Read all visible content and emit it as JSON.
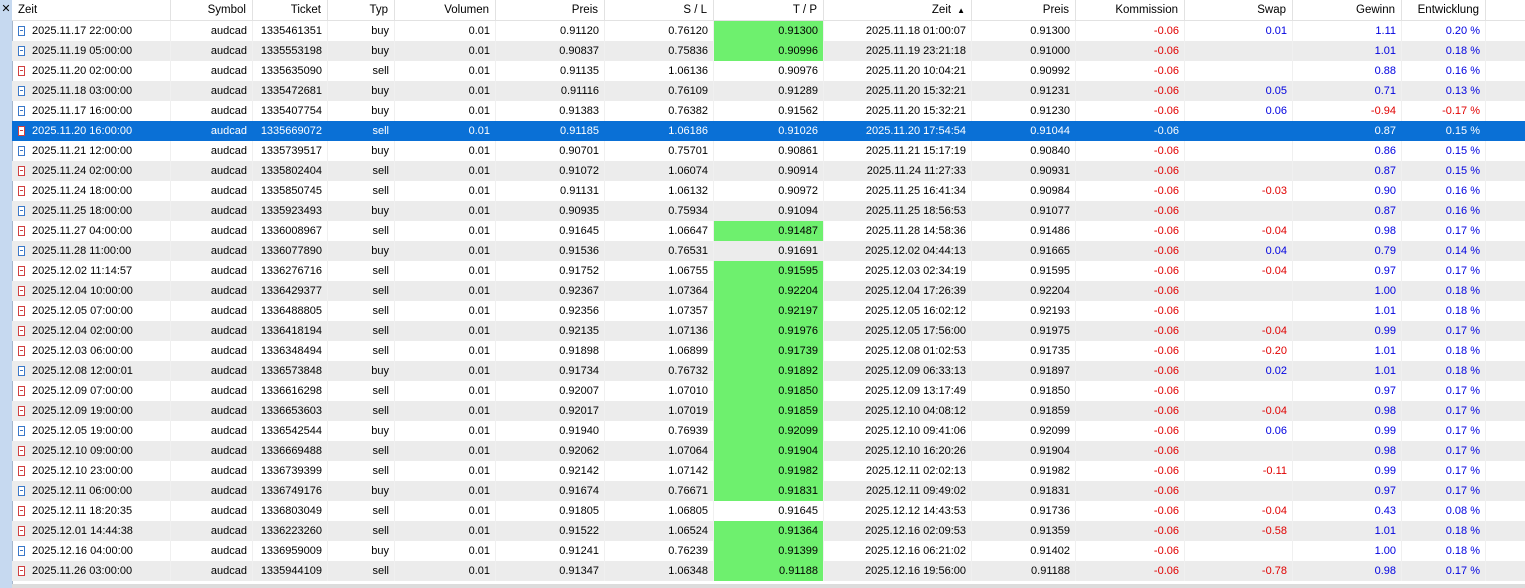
{
  "columns": [
    "Zeit",
    "Symbol",
    "Ticket",
    "Typ",
    "Volumen",
    "Preis",
    "S / L",
    "T / P",
    "Zeit",
    "Preis",
    "Kommission",
    "Swap",
    "Gewinn",
    "Entwicklung"
  ],
  "sort": {
    "column_index": 8,
    "direction": "ascending"
  },
  "colors": {
    "selected_row": "#0a70d6",
    "tp_hit": "#6ef06e",
    "negative": "#e00000",
    "positive": "#0000e0",
    "alt_row": "#ececec"
  },
  "selected_index": 5,
  "rows": [
    {
      "open_time": "2025.11.17 22:00:00",
      "symbol": "audcad",
      "ticket": "1335461351",
      "type": "buy",
      "volume": "0.01",
      "open_price": "0.91120",
      "sl": "0.76120",
      "tp": "0.91300",
      "tp_hit": true,
      "close_time": "2025.11.18 01:00:07",
      "close_price": "0.91300",
      "commission": "-0.06",
      "swap": "0.01",
      "profit": "1.11",
      "change": "0.20 %"
    },
    {
      "open_time": "2025.11.19 05:00:00",
      "symbol": "audcad",
      "ticket": "1335553198",
      "type": "buy",
      "volume": "0.01",
      "open_price": "0.90837",
      "sl": "0.75836",
      "tp": "0.90996",
      "tp_hit": true,
      "close_time": "2025.11.19 23:21:18",
      "close_price": "0.91000",
      "commission": "-0.06",
      "swap": "",
      "profit": "1.01",
      "change": "0.18 %"
    },
    {
      "open_time": "2025.11.20 02:00:00",
      "symbol": "audcad",
      "ticket": "1335635090",
      "type": "sell",
      "volume": "0.01",
      "open_price": "0.91135",
      "sl": "1.06136",
      "tp": "0.90976",
      "tp_hit": false,
      "close_time": "2025.11.20 10:04:21",
      "close_price": "0.90992",
      "commission": "-0.06",
      "swap": "",
      "profit": "0.88",
      "change": "0.16 %"
    },
    {
      "open_time": "2025.11.18 03:00:00",
      "symbol": "audcad",
      "ticket": "1335472681",
      "type": "buy",
      "volume": "0.01",
      "open_price": "0.91116",
      "sl": "0.76109",
      "tp": "0.91289",
      "tp_hit": false,
      "close_time": "2025.11.20 15:32:21",
      "close_price": "0.91231",
      "commission": "-0.06",
      "swap": "0.05",
      "profit": "0.71",
      "change": "0.13 %"
    },
    {
      "open_time": "2025.11.17 16:00:00",
      "symbol": "audcad",
      "ticket": "1335407754",
      "type": "buy",
      "volume": "0.01",
      "open_price": "0.91383",
      "sl": "0.76382",
      "tp": "0.91562",
      "tp_hit": false,
      "close_time": "2025.11.20 15:32:21",
      "close_price": "0.91230",
      "commission": "-0.06",
      "swap": "0.06",
      "profit": "-0.94",
      "change": "-0.17 %"
    },
    {
      "open_time": "2025.11.20 16:00:00",
      "symbol": "audcad",
      "ticket": "1335669072",
      "type": "sell",
      "volume": "0.01",
      "open_price": "0.91185",
      "sl": "1.06186",
      "tp": "0.91026",
      "tp_hit": false,
      "close_time": "2025.11.20 17:54:54",
      "close_price": "0.91044",
      "commission": "-0.06",
      "swap": "",
      "profit": "0.87",
      "change": "0.15 %"
    },
    {
      "open_time": "2025.11.21 12:00:00",
      "symbol": "audcad",
      "ticket": "1335739517",
      "type": "buy",
      "volume": "0.01",
      "open_price": "0.90701",
      "sl": "0.75701",
      "tp": "0.90861",
      "tp_hit": false,
      "close_time": "2025.11.21 15:17:19",
      "close_price": "0.90840",
      "commission": "-0.06",
      "swap": "",
      "profit": "0.86",
      "change": "0.15 %"
    },
    {
      "open_time": "2025.11.24 02:00:00",
      "symbol": "audcad",
      "ticket": "1335802404",
      "type": "sell",
      "volume": "0.01",
      "open_price": "0.91072",
      "sl": "1.06074",
      "tp": "0.90914",
      "tp_hit": false,
      "close_time": "2025.11.24 11:27:33",
      "close_price": "0.90931",
      "commission": "-0.06",
      "swap": "",
      "profit": "0.87",
      "change": "0.15 %"
    },
    {
      "open_time": "2025.11.24 18:00:00",
      "symbol": "audcad",
      "ticket": "1335850745",
      "type": "sell",
      "volume": "0.01",
      "open_price": "0.91131",
      "sl": "1.06132",
      "tp": "0.90972",
      "tp_hit": false,
      "close_time": "2025.11.25 16:41:34",
      "close_price": "0.90984",
      "commission": "-0.06",
      "swap": "-0.03",
      "profit": "0.90",
      "change": "0.16 %"
    },
    {
      "open_time": "2025.11.25 18:00:00",
      "symbol": "audcad",
      "ticket": "1335923493",
      "type": "buy",
      "volume": "0.01",
      "open_price": "0.90935",
      "sl": "0.75934",
      "tp": "0.91094",
      "tp_hit": false,
      "close_time": "2025.11.25 18:56:53",
      "close_price": "0.91077",
      "commission": "-0.06",
      "swap": "",
      "profit": "0.87",
      "change": "0.16 %"
    },
    {
      "open_time": "2025.11.27 04:00:00",
      "symbol": "audcad",
      "ticket": "1336008967",
      "type": "sell",
      "volume": "0.01",
      "open_price": "0.91645",
      "sl": "1.06647",
      "tp": "0.91487",
      "tp_hit": true,
      "close_time": "2025.11.28 14:58:36",
      "close_price": "0.91486",
      "commission": "-0.06",
      "swap": "-0.04",
      "profit": "0.98",
      "change": "0.17 %"
    },
    {
      "open_time": "2025.11.28 11:00:00",
      "symbol": "audcad",
      "ticket": "1336077890",
      "type": "buy",
      "volume": "0.01",
      "open_price": "0.91536",
      "sl": "0.76531",
      "tp": "0.91691",
      "tp_hit": false,
      "close_time": "2025.12.02 04:44:13",
      "close_price": "0.91665",
      "commission": "-0.06",
      "swap": "0.04",
      "profit": "0.79",
      "change": "0.14 %"
    },
    {
      "open_time": "2025.12.02 11:14:57",
      "symbol": "audcad",
      "ticket": "1336276716",
      "type": "sell",
      "volume": "0.01",
      "open_price": "0.91752",
      "sl": "1.06755",
      "tp": "0.91595",
      "tp_hit": true,
      "close_time": "2025.12.03 02:34:19",
      "close_price": "0.91595",
      "commission": "-0.06",
      "swap": "-0.04",
      "profit": "0.97",
      "change": "0.17 %"
    },
    {
      "open_time": "2025.12.04 10:00:00",
      "symbol": "audcad",
      "ticket": "1336429377",
      "type": "sell",
      "volume": "0.01",
      "open_price": "0.92367",
      "sl": "1.07364",
      "tp": "0.92204",
      "tp_hit": true,
      "close_time": "2025.12.04 17:26:39",
      "close_price": "0.92204",
      "commission": "-0.06",
      "swap": "",
      "profit": "1.00",
      "change": "0.18 %"
    },
    {
      "open_time": "2025.12.05 07:00:00",
      "symbol": "audcad",
      "ticket": "1336488805",
      "type": "sell",
      "volume": "0.01",
      "open_price": "0.92356",
      "sl": "1.07357",
      "tp": "0.92197",
      "tp_hit": true,
      "close_time": "2025.12.05 16:02:12",
      "close_price": "0.92193",
      "commission": "-0.06",
      "swap": "",
      "profit": "1.01",
      "change": "0.18 %"
    },
    {
      "open_time": "2025.12.04 02:00:00",
      "symbol": "audcad",
      "ticket": "1336418194",
      "type": "sell",
      "volume": "0.01",
      "open_price": "0.92135",
      "sl": "1.07136",
      "tp": "0.91976",
      "tp_hit": true,
      "close_time": "2025.12.05 17:56:00",
      "close_price": "0.91975",
      "commission": "-0.06",
      "swap": "-0.04",
      "profit": "0.99",
      "change": "0.17 %"
    },
    {
      "open_time": "2025.12.03 06:00:00",
      "symbol": "audcad",
      "ticket": "1336348494",
      "type": "sell",
      "volume": "0.01",
      "open_price": "0.91898",
      "sl": "1.06899",
      "tp": "0.91739",
      "tp_hit": true,
      "close_time": "2025.12.08 01:02:53",
      "close_price": "0.91735",
      "commission": "-0.06",
      "swap": "-0.20",
      "profit": "1.01",
      "change": "0.18 %"
    },
    {
      "open_time": "2025.12.08 12:00:01",
      "symbol": "audcad",
      "ticket": "1336573848",
      "type": "buy",
      "volume": "0.01",
      "open_price": "0.91734",
      "sl": "0.76732",
      "tp": "0.91892",
      "tp_hit": true,
      "close_time": "2025.12.09 06:33:13",
      "close_price": "0.91897",
      "commission": "-0.06",
      "swap": "0.02",
      "profit": "1.01",
      "change": "0.18 %"
    },
    {
      "open_time": "2025.12.09 07:00:00",
      "symbol": "audcad",
      "ticket": "1336616298",
      "type": "sell",
      "volume": "0.01",
      "open_price": "0.92007",
      "sl": "1.07010",
      "tp": "0.91850",
      "tp_hit": true,
      "close_time": "2025.12.09 13:17:49",
      "close_price": "0.91850",
      "commission": "-0.06",
      "swap": "",
      "profit": "0.97",
      "change": "0.17 %"
    },
    {
      "open_time": "2025.12.09 19:00:00",
      "symbol": "audcad",
      "ticket": "1336653603",
      "type": "sell",
      "volume": "0.01",
      "open_price": "0.92017",
      "sl": "1.07019",
      "tp": "0.91859",
      "tp_hit": true,
      "close_time": "2025.12.10 04:08:12",
      "close_price": "0.91859",
      "commission": "-0.06",
      "swap": "-0.04",
      "profit": "0.98",
      "change": "0.17 %"
    },
    {
      "open_time": "2025.12.05 19:00:00",
      "symbol": "audcad",
      "ticket": "1336542544",
      "type": "buy",
      "volume": "0.01",
      "open_price": "0.91940",
      "sl": "0.76939",
      "tp": "0.92099",
      "tp_hit": true,
      "close_time": "2025.12.10 09:41:06",
      "close_price": "0.92099",
      "commission": "-0.06",
      "swap": "0.06",
      "profit": "0.99",
      "change": "0.17 %"
    },
    {
      "open_time": "2025.12.10 09:00:00",
      "symbol": "audcad",
      "ticket": "1336669488",
      "type": "sell",
      "volume": "0.01",
      "open_price": "0.92062",
      "sl": "1.07064",
      "tp": "0.91904",
      "tp_hit": true,
      "close_time": "2025.12.10 16:20:26",
      "close_price": "0.91904",
      "commission": "-0.06",
      "swap": "",
      "profit": "0.98",
      "change": "0.17 %"
    },
    {
      "open_time": "2025.12.10 23:00:00",
      "symbol": "audcad",
      "ticket": "1336739399",
      "type": "sell",
      "volume": "0.01",
      "open_price": "0.92142",
      "sl": "1.07142",
      "tp": "0.91982",
      "tp_hit": true,
      "close_time": "2025.12.11 02:02:13",
      "close_price": "0.91982",
      "commission": "-0.06",
      "swap": "-0.11",
      "profit": "0.99",
      "change": "0.17 %"
    },
    {
      "open_time": "2025.12.11 06:00:00",
      "symbol": "audcad",
      "ticket": "1336749176",
      "type": "buy",
      "volume": "0.01",
      "open_price": "0.91674",
      "sl": "0.76671",
      "tp": "0.91831",
      "tp_hit": true,
      "close_time": "2025.12.11 09:49:02",
      "close_price": "0.91831",
      "commission": "-0.06",
      "swap": "",
      "profit": "0.97",
      "change": "0.17 %"
    },
    {
      "open_time": "2025.12.11 18:20:35",
      "symbol": "audcad",
      "ticket": "1336803049",
      "type": "sell",
      "volume": "0.01",
      "open_price": "0.91805",
      "sl": "1.06805",
      "tp": "0.91645",
      "tp_hit": false,
      "close_time": "2025.12.12 14:43:53",
      "close_price": "0.91736",
      "commission": "-0.06",
      "swap": "-0.04",
      "profit": "0.43",
      "change": "0.08 %"
    },
    {
      "open_time": "2025.12.01 14:44:38",
      "symbol": "audcad",
      "ticket": "1336223260",
      "type": "sell",
      "volume": "0.01",
      "open_price": "0.91522",
      "sl": "1.06524",
      "tp": "0.91364",
      "tp_hit": true,
      "close_time": "2025.12.16 02:09:53",
      "close_price": "0.91359",
      "commission": "-0.06",
      "swap": "-0.58",
      "profit": "1.01",
      "change": "0.18 %"
    },
    {
      "open_time": "2025.12.16 04:00:00",
      "symbol": "audcad",
      "ticket": "1336959009",
      "type": "buy",
      "volume": "0.01",
      "open_price": "0.91241",
      "sl": "0.76239",
      "tp": "0.91399",
      "tp_hit": true,
      "close_time": "2025.12.16 06:21:02",
      "close_price": "0.91402",
      "commission": "-0.06",
      "swap": "",
      "profit": "1.00",
      "change": "0.18 %"
    },
    {
      "open_time": "2025.11.26 03:00:00",
      "symbol": "audcad",
      "ticket": "1335944109",
      "type": "sell",
      "volume": "0.01",
      "open_price": "0.91347",
      "sl": "1.06348",
      "tp": "0.91188",
      "tp_hit": true,
      "close_time": "2025.12.16 19:56:00",
      "close_price": "0.91188",
      "commission": "-0.06",
      "swap": "-0.78",
      "profit": "0.98",
      "change": "0.17 %"
    }
  ]
}
